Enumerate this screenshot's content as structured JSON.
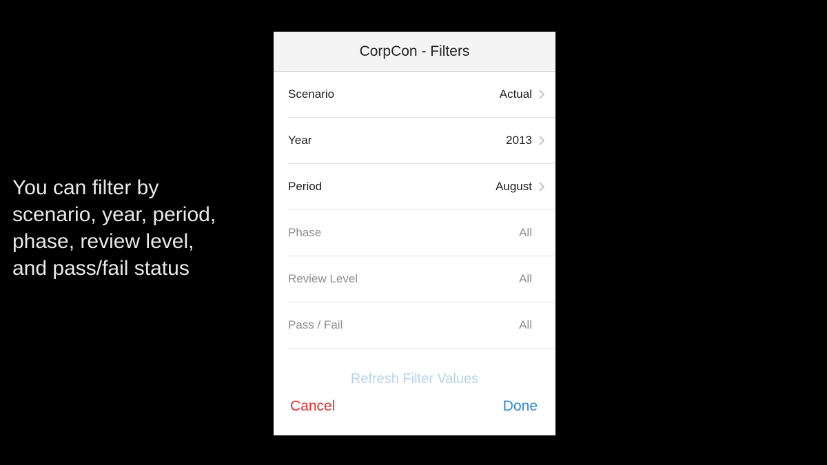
{
  "caption": {
    "lines": [
      "You can filter by",
      "scenario, year, period,",
      "phase, review level,",
      "and pass/fail status"
    ]
  },
  "navbar": {
    "title": "CorpCon - Filters"
  },
  "filters": [
    {
      "label": "Scenario",
      "value": "Actual",
      "enabled": true
    },
    {
      "label": "Year",
      "value": "2013",
      "enabled": true
    },
    {
      "label": "Period",
      "value": "August",
      "enabled": true
    },
    {
      "label": "Phase",
      "value": "All",
      "enabled": false
    },
    {
      "label": "Review Level",
      "value": "All",
      "enabled": false
    },
    {
      "label": "Pass / Fail",
      "value": "All",
      "enabled": false
    }
  ],
  "actions": {
    "refresh_label": "Refresh Filter Values",
    "cancel_label": "Cancel",
    "done_label": "Done"
  },
  "colors": {
    "cancel": "#e5312b",
    "done": "#2f89d1",
    "refresh": "#b8d4ea"
  }
}
